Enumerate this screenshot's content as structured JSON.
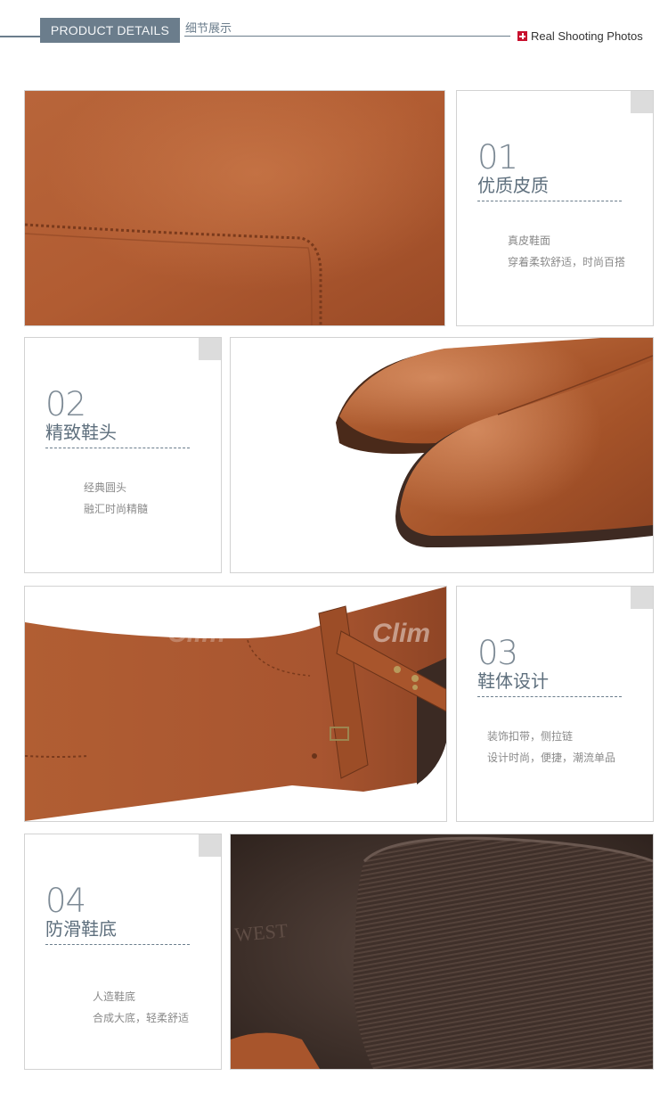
{
  "header": {
    "tab_label": "PRODUCT  DETAILS",
    "subtitle_cn": "细节展示",
    "real_photos": "Real Shooting Photos"
  },
  "colors": {
    "accent": "#6b7d8c",
    "leather": "#b15e33",
    "sole": "#4a3b35",
    "marker": "#c8102e"
  },
  "details": [
    {
      "num": "01",
      "title": "优质皮质",
      "line1": "真皮鞋面",
      "line2": "穿着柔软舒适，时尚百搭"
    },
    {
      "num": "02",
      "title": "精致鞋头",
      "line1": "经典圆头",
      "line2": "融汇时尚精髓"
    },
    {
      "num": "03",
      "title": "鞋体设计",
      "line1": "装饰扣带，侧拉链",
      "line2": "设计时尚，便捷，潮流单品"
    },
    {
      "num": "04",
      "title": "防滑鞋底",
      "line1": "人造鞋底",
      "line2": "合成大底，轻柔舒适"
    }
  ],
  "photos": {
    "p1": "leather-closeup",
    "p2": "round-toe-closeup",
    "p3": "buckle-strap-closeup",
    "p4": "outsole-closeup",
    "watermark": "Clim",
    "sole_brand": "WEST"
  }
}
